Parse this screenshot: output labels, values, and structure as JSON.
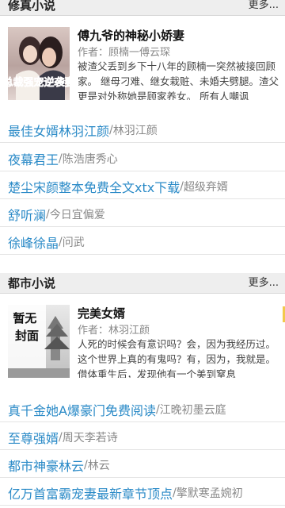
{
  "sections": [
    {
      "title": "修真小说",
      "more_label": "更多...",
      "featured": {
        "title": "傅九爷的神秘小娇妻",
        "author_label": "作者：",
        "author": "顾楠一傅云琛",
        "description": "被渣父丢到乡下十八年的顾楠一突然被接回顾家。 继母刁难、继女栽赃、未婚夫劈腿。渣父更是对外称她是顾家养女。 所有人嘲讽",
        "cover_text": "总裁强宠逆袭妻"
      },
      "items": [
        {
          "title": "最佳女婿林羽江颜",
          "author": "林羽江颜"
        },
        {
          "title": "夜幕君王",
          "author": "陈浩唐秀心"
        },
        {
          "title": "楚尘宋颜整本免费全文xtx下载",
          "author": "超级弃婿"
        },
        {
          "title": "舒听澜",
          "author": "今日宜偏爱"
        },
        {
          "title": "徐峰徐晶",
          "author": "问武"
        }
      ]
    },
    {
      "title": "都市小说",
      "more_label": "更多...",
      "featured": {
        "title": "完美女婿",
        "author_label": "作者：",
        "author": "林羽江颜",
        "description": "人死的时候会有意识吗？会，因为我经历过。这个世界上真的有鬼吗？有，因为，我就是。借体重生后，发现他有一个美到窒息",
        "cover_text": "暂无封面"
      },
      "items": [
        {
          "title": "真千金她A爆豪门免费阅读",
          "author": "江晚初墨云庭"
        },
        {
          "title": "至尊强婿",
          "author": "周天李若诗"
        },
        {
          "title": "都市神豪林云",
          "author": "林云"
        },
        {
          "title": "亿万首富霸宠妻最新章节顶点",
          "author": "擎默寒孟婉初"
        }
      ]
    }
  ],
  "separator": "/",
  "colors": {
    "link": "#2a8ac7",
    "header_bg": "#eeeeee",
    "accent": "#f2c94c"
  }
}
